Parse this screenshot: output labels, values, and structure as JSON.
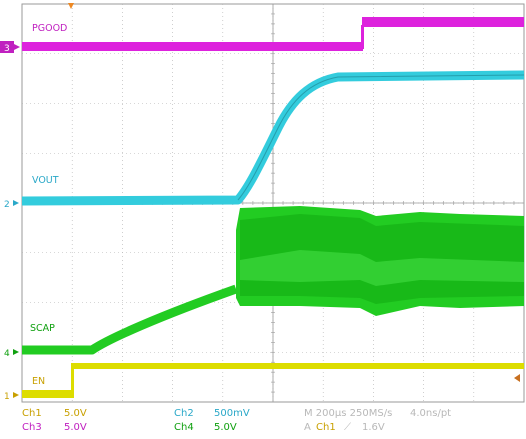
{
  "traces": {
    "pgood": {
      "label": "PGOOD",
      "marker": "3",
      "color": "#dd22dd"
    },
    "vout": {
      "label": "VOUT",
      "marker": "2",
      "color": "#33ccdd"
    },
    "scap": {
      "label": "SCAP",
      "marker": "4",
      "color": "#22cc22"
    },
    "en": {
      "label": "EN",
      "marker": "1",
      "color": "#dddd00"
    }
  },
  "status": {
    "ch1_name": "Ch1",
    "ch1_scale": "5.0V",
    "ch2_name": "Ch2",
    "ch2_scale": "500mV",
    "ch3_name": "Ch3",
    "ch3_scale": "5.0V",
    "ch4_name": "Ch4",
    "ch4_scale": "5.0V",
    "timebase": "M 200µs 250MS/s",
    "resolution": "4.0ns/pt",
    "trigger_mode": "A",
    "trigger_source": "Ch1",
    "trigger_slope": "⟋",
    "trigger_level": "1.6V"
  },
  "colors": {
    "ch1": "#c8a000",
    "ch2": "#2aa8c8",
    "ch3": "#c020c0",
    "ch4": "#10a010",
    "grid": "#aaaaaa",
    "text_dim": "#b0b0b0"
  }
}
